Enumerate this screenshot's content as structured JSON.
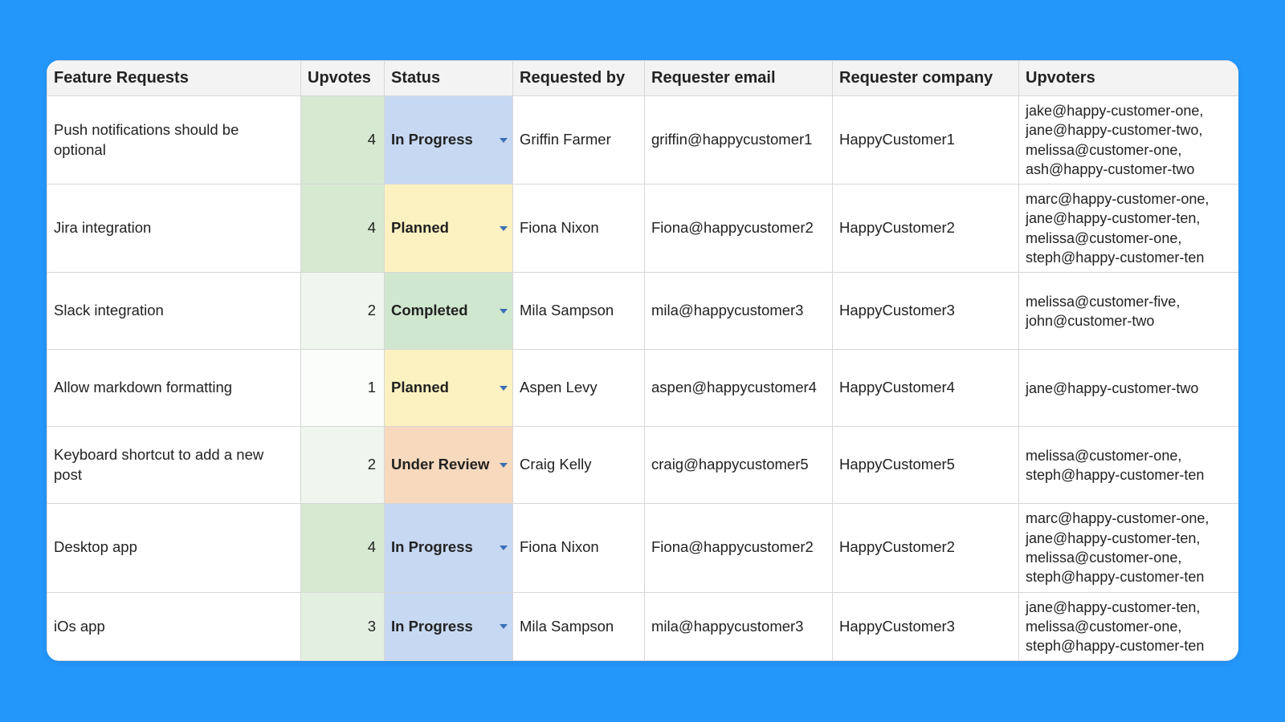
{
  "columns": {
    "feature": "Feature Requests",
    "upvotes": "Upvotes",
    "status": "Status",
    "requested_by": "Requested by",
    "requester_email": "Requester email",
    "requester_company": "Requester company",
    "upvoters": "Upvoters"
  },
  "status_styles": {
    "In Progress": "st-inprogress",
    "Planned": "st-planned",
    "Completed": "st-completed",
    "Under Review": "st-underreview"
  },
  "rows": [
    {
      "feature": "Push notifications should be optional",
      "upvotes": 4,
      "status": "In Progress",
      "requested_by": "Griffin Farmer",
      "requester_email": "griffin@happycustomer1",
      "requester_company": "HappyCustomer1",
      "upvoters": "jake@happy-customer-one, jane@happy-customer-two, melissa@customer-one, ash@happy-customer-two"
    },
    {
      "feature": "Jira integration",
      "upvotes": 4,
      "status": "Planned",
      "requested_by": "Fiona Nixon",
      "requester_email": "Fiona@happycustomer2",
      "requester_company": "HappyCustomer2",
      "upvoters": "marc@happy-customer-one, jane@happy-customer-ten, melissa@customer-one, steph@happy-customer-ten"
    },
    {
      "feature": "Slack integration",
      "upvotes": 2,
      "status": "Completed",
      "requested_by": "Mila Sampson",
      "requester_email": "mila@happycustomer3",
      "requester_company": "HappyCustomer3",
      "upvoters": "melissa@customer-five, john@customer-two"
    },
    {
      "feature": "Allow markdown formatting",
      "upvotes": 1,
      "status": "Planned",
      "requested_by": "Aspen Levy",
      "requester_email": "aspen@happycustomer4",
      "requester_company": "HappyCustomer4",
      "upvoters": "jane@happy-customer-two"
    },
    {
      "feature": "Keyboard shortcut to add a new post",
      "upvotes": 2,
      "status": "Under Review",
      "requested_by": "Craig Kelly",
      "requester_email": "craig@happycustomer5",
      "requester_company": "HappyCustomer5",
      "upvoters": "melissa@customer-one, steph@happy-customer-ten"
    },
    {
      "feature": "Desktop app",
      "upvotes": 4,
      "status": "In Progress",
      "requested_by": "Fiona Nixon",
      "requester_email": "Fiona@happycustomer2",
      "requester_company": "HappyCustomer2",
      "upvoters": "marc@happy-customer-one, jane@happy-customer-ten, melissa@customer-one, steph@happy-customer-ten"
    },
    {
      "feature": "iOs app",
      "upvotes": 3,
      "status": "In Progress",
      "requested_by": "Mila Sampson",
      "requester_email": "mila@happycustomer3",
      "requester_company": "HappyCustomer3",
      "upvoters": "jane@happy-customer-ten, melissa@customer-one, steph@happy-customer-ten"
    }
  ]
}
